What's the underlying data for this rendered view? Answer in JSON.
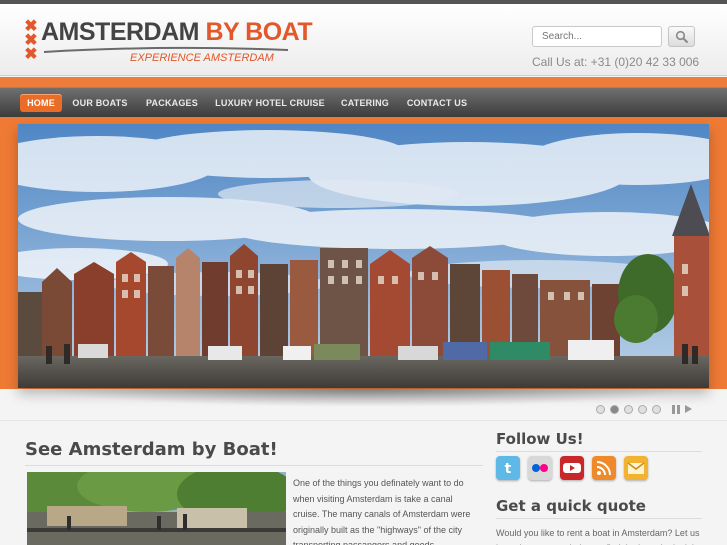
{
  "brand": {
    "name_part1": "AMSTERDAM",
    "name_part2": "BY BOAT",
    "tagline": "EXPERIENCE AMSTERDAM",
    "crosses": [
      "✖",
      "✖",
      "✖"
    ]
  },
  "search": {
    "placeholder": "Search...",
    "icon": "magnifier-icon"
  },
  "contact": {
    "phone_text": "Call Us at: +31 (0)20 42 33 006"
  },
  "nav": {
    "items": [
      {
        "label": "HOME",
        "active": true
      },
      {
        "label": "OUR BOATS",
        "active": false
      },
      {
        "label": "PACKAGES",
        "active": false
      },
      {
        "label": "LUXURY HOTEL CRUISE",
        "active": false
      },
      {
        "label": "CATERING",
        "active": false
      },
      {
        "label": "CONTACT US",
        "active": false
      }
    ]
  },
  "slider": {
    "slide_count": 5,
    "active_slide": 1,
    "controls": [
      "pause-icon",
      "next-icon"
    ]
  },
  "main": {
    "heading": "See Amsterdam by Boat!",
    "paragraph": "One of the things you definately want to do when visiting Amsterdam is take a canal cruise. The many canals of Amsterdam were originally built as the \"highways\" of the city transporting passangers and goods"
  },
  "sidebar": {
    "follow_heading": "Follow Us!",
    "social": [
      {
        "name": "twitter-icon",
        "color": "#5fb9e6"
      },
      {
        "name": "flickr-icon",
        "color": "#c8c8c8"
      },
      {
        "name": "youtube-icon",
        "color": "#c8282a"
      },
      {
        "name": "rss-icon",
        "color": "#ef8a2a"
      },
      {
        "name": "email-icon",
        "color": "#f2b232"
      }
    ],
    "quote_heading": "Get a quick quote",
    "quote_text": "Would you like to rent a boat in Amsterdam? Let us know how we can help you find the boat that's right for you"
  },
  "colors": {
    "accent": "#e96d26",
    "nav_bg": "#4a4a4a",
    "band": "#ee7c3a"
  }
}
